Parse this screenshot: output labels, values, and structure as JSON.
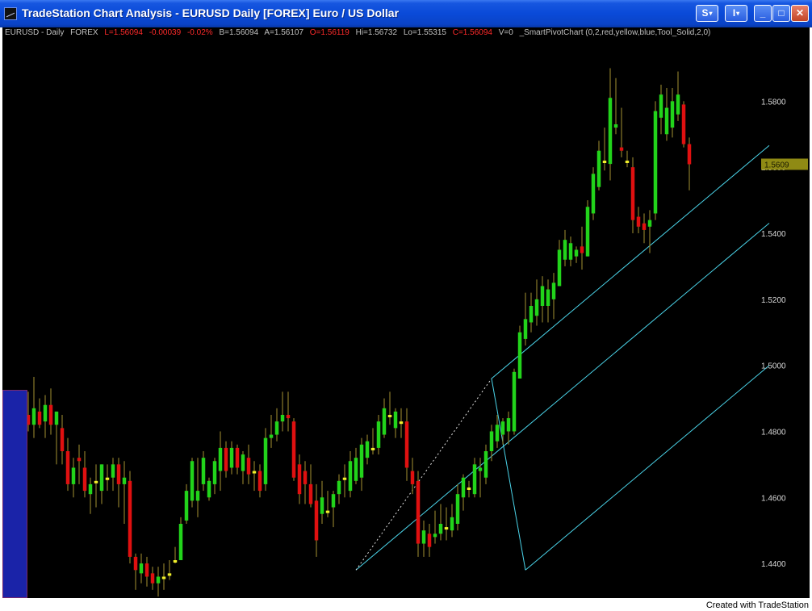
{
  "window": {
    "title": "TradeStation Chart Analysis - EURUSD  Daily  [FOREX] Euro / US Dollar",
    "buttons": {
      "s_label": "S",
      "i_label": "I",
      "caret": "▾",
      "minimize": "_",
      "maximize": "□",
      "close": "✕"
    }
  },
  "status": {
    "symbol": "EURUSD - Daily",
    "exchange": "FOREX",
    "last": "L=1.56094",
    "net_change": "-0.00039",
    "pct_change": "-0.02%",
    "bid": "B=1.56094",
    "ask": "A=1.56107",
    "open": "O=1.56119",
    "high": "Hi=1.56732",
    "low": "Lo=1.55315",
    "close": "C=1.56094",
    "volume": "V=0",
    "indicator": "_SmartPivotChart  (0,2,red,yellow,blue,Tool_Solid,2,0)"
  },
  "price_axis": {
    "labels": [
      "1.5800",
      "1.5600",
      "1.5400",
      "1.5200",
      "1.5000",
      "1.4800",
      "1.4600",
      "1.4400"
    ],
    "current_price_label": "1.5609"
  },
  "footer": {
    "watermark": "Created with TradeStation"
  },
  "chart_data": {
    "type": "candlestick",
    "symbol": "EURUSD",
    "interval": "Daily",
    "y_range": [
      1.43,
      1.595
    ],
    "y_ticks": [
      1.44,
      1.46,
      1.48,
      1.5,
      1.52,
      1.54,
      1.56,
      1.58
    ],
    "last_price": 1.5609,
    "colors": {
      "up": "#22d41b",
      "down": "#e01010",
      "doji": "#f0f02a",
      "wick": "#8a7a2a",
      "channel": "#4ad3e8",
      "pivot_line": "#e0e0e0",
      "background": "#000000",
      "last_price_tag": "#8f8a14"
    },
    "candles": [
      {
        "o": 1.464,
        "h": 1.4685,
        "l": 1.458,
        "c": 1.466
      },
      {
        "o": 1.466,
        "h": 1.469,
        "l": 1.462,
        "c": 1.463
      },
      {
        "o": 1.464,
        "h": 1.48,
        "l": 1.462,
        "c": 1.478
      },
      {
        "o": 1.477,
        "h": 1.49,
        "l": 1.474,
        "c": 1.487
      },
      {
        "o": 1.485,
        "h": 1.492,
        "l": 1.48,
        "c": 1.482
      },
      {
        "o": 1.482,
        "h": 1.4965,
        "l": 1.478,
        "c": 1.487
      },
      {
        "o": 1.486,
        "h": 1.49,
        "l": 1.481,
        "c": 1.482
      },
      {
        "o": 1.483,
        "h": 1.491,
        "l": 1.478,
        "c": 1.488
      },
      {
        "o": 1.488,
        "h": 1.493,
        "l": 1.479,
        "c": 1.482
      },
      {
        "o": 1.482,
        "h": 1.486,
        "l": 1.47,
        "c": 1.486
      },
      {
        "o": 1.481,
        "h": 1.485,
        "l": 1.47,
        "c": 1.474
      },
      {
        "o": 1.474,
        "h": 1.478,
        "l": 1.462,
        "c": 1.464
      },
      {
        "o": 1.464,
        "h": 1.472,
        "l": 1.46,
        "c": 1.469
      },
      {
        "o": 1.472,
        "h": 1.476,
        "l": 1.464,
        "c": 1.471
      },
      {
        "o": 1.469,
        "h": 1.474,
        "l": 1.46,
        "c": 1.462
      },
      {
        "o": 1.461,
        "h": 1.466,
        "l": 1.455,
        "c": 1.464
      },
      {
        "o": 1.465,
        "h": 1.47,
        "l": 1.457,
        "c": 1.465
      },
      {
        "o": 1.462,
        "h": 1.47,
        "l": 1.458,
        "c": 1.47
      },
      {
        "o": 1.466,
        "h": 1.47,
        "l": 1.462,
        "c": 1.466
      },
      {
        "o": 1.466,
        "h": 1.472,
        "l": 1.462,
        "c": 1.47
      },
      {
        "o": 1.47,
        "h": 1.472,
        "l": 1.457,
        "c": 1.464
      },
      {
        "o": 1.464,
        "h": 1.471,
        "l": 1.452,
        "c": 1.466
      },
      {
        "o": 1.465,
        "h": 1.468,
        "l": 1.44,
        "c": 1.442
      },
      {
        "o": 1.442,
        "h": 1.443,
        "l": 1.432,
        "c": 1.438
      },
      {
        "o": 1.437,
        "h": 1.443,
        "l": 1.434,
        "c": 1.44
      },
      {
        "o": 1.44,
        "h": 1.442,
        "l": 1.433,
        "c": 1.436
      },
      {
        "o": 1.437,
        "h": 1.439,
        "l": 1.432,
        "c": 1.434
      },
      {
        "o": 1.434,
        "h": 1.439,
        "l": 1.43,
        "c": 1.436
      },
      {
        "o": 1.436,
        "h": 1.44,
        "l": 1.432,
        "c": 1.436
      },
      {
        "o": 1.437,
        "h": 1.441,
        "l": 1.435,
        "c": 1.437
      },
      {
        "o": 1.441,
        "h": 1.445,
        "l": 1.44,
        "c": 1.441
      },
      {
        "o": 1.441,
        "h": 1.454,
        "l": 1.441,
        "c": 1.452
      },
      {
        "o": 1.453,
        "h": 1.464,
        "l": 1.452,
        "c": 1.462
      },
      {
        "o": 1.459,
        "h": 1.472,
        "l": 1.457,
        "c": 1.471
      },
      {
        "o": 1.459,
        "h": 1.472,
        "l": 1.454,
        "c": 1.462
      },
      {
        "o": 1.464,
        "h": 1.474,
        "l": 1.462,
        "c": 1.472
      },
      {
        "o": 1.46,
        "h": 1.466,
        "l": 1.459,
        "c": 1.465
      },
      {
        "o": 1.464,
        "h": 1.472,
        "l": 1.461,
        "c": 1.471
      },
      {
        "o": 1.468,
        "h": 1.48,
        "l": 1.462,
        "c": 1.475
      },
      {
        "o": 1.475,
        "h": 1.477,
        "l": 1.466,
        "c": 1.468
      },
      {
        "o": 1.469,
        "h": 1.477,
        "l": 1.467,
        "c": 1.475
      },
      {
        "o": 1.475,
        "h": 1.476,
        "l": 1.467,
        "c": 1.469
      },
      {
        "o": 1.468,
        "h": 1.474,
        "l": 1.464,
        "c": 1.473
      },
      {
        "o": 1.472,
        "h": 1.476,
        "l": 1.464,
        "c": 1.467
      },
      {
        "o": 1.468,
        "h": 1.471,
        "l": 1.462,
        "c": 1.468
      },
      {
        "o": 1.468,
        "h": 1.47,
        "l": 1.46,
        "c": 1.462
      },
      {
        "o": 1.464,
        "h": 1.481,
        "l": 1.462,
        "c": 1.478
      },
      {
        "o": 1.478,
        "h": 1.485,
        "l": 1.475,
        "c": 1.479
      },
      {
        "o": 1.479,
        "h": 1.487,
        "l": 1.477,
        "c": 1.483
      },
      {
        "o": 1.483,
        "h": 1.492,
        "l": 1.48,
        "c": 1.485
      },
      {
        "o": 1.485,
        "h": 1.492,
        "l": 1.48,
        "c": 1.484
      },
      {
        "o": 1.483,
        "h": 1.484,
        "l": 1.465,
        "c": 1.466
      },
      {
        "o": 1.47,
        "h": 1.473,
        "l": 1.458,
        "c": 1.461
      },
      {
        "o": 1.468,
        "h": 1.471,
        "l": 1.458,
        "c": 1.464
      },
      {
        "o": 1.464,
        "h": 1.47,
        "l": 1.457,
        "c": 1.458
      },
      {
        "o": 1.459,
        "h": 1.464,
        "l": 1.442,
        "c": 1.447
      },
      {
        "o": 1.455,
        "h": 1.465,
        "l": 1.452,
        "c": 1.46
      },
      {
        "o": 1.456,
        "h": 1.462,
        "l": 1.454,
        "c": 1.456
      },
      {
        "o": 1.457,
        "h": 1.462,
        "l": 1.451,
        "c": 1.461
      },
      {
        "o": 1.461,
        "h": 1.467,
        "l": 1.458,
        "c": 1.465
      },
      {
        "o": 1.466,
        "h": 1.47,
        "l": 1.46,
        "c": 1.466
      },
      {
        "o": 1.462,
        "h": 1.474,
        "l": 1.46,
        "c": 1.471
      },
      {
        "o": 1.465,
        "h": 1.475,
        "l": 1.464,
        "c": 1.472
      },
      {
        "o": 1.466,
        "h": 1.478,
        "l": 1.462,
        "c": 1.476
      },
      {
        "o": 1.472,
        "h": 1.479,
        "l": 1.47,
        "c": 1.477
      },
      {
        "o": 1.475,
        "h": 1.481,
        "l": 1.473,
        "c": 1.475
      },
      {
        "o": 1.475,
        "h": 1.485,
        "l": 1.473,
        "c": 1.483
      },
      {
        "o": 1.479,
        "h": 1.49,
        "l": 1.478,
        "c": 1.487
      },
      {
        "o": 1.485,
        "h": 1.492,
        "l": 1.482,
        "c": 1.485
      },
      {
        "o": 1.481,
        "h": 1.487,
        "l": 1.478,
        "c": 1.486
      },
      {
        "o": 1.483,
        "h": 1.487,
        "l": 1.478,
        "c": 1.483
      },
      {
        "o": 1.483,
        "h": 1.487,
        "l": 1.465,
        "c": 1.469
      },
      {
        "o": 1.468,
        "h": 1.472,
        "l": 1.461,
        "c": 1.464
      },
      {
        "o": 1.465,
        "h": 1.468,
        "l": 1.442,
        "c": 1.446
      },
      {
        "o": 1.446,
        "h": 1.453,
        "l": 1.442,
        "c": 1.45
      },
      {
        "o": 1.449,
        "h": 1.452,
        "l": 1.442,
        "c": 1.445
      },
      {
        "o": 1.448,
        "h": 1.456,
        "l": 1.446,
        "c": 1.449
      },
      {
        "o": 1.449,
        "h": 1.458,
        "l": 1.447,
        "c": 1.452
      },
      {
        "o": 1.451,
        "h": 1.457,
        "l": 1.447,
        "c": 1.451
      },
      {
        "o": 1.45,
        "h": 1.458,
        "l": 1.448,
        "c": 1.454
      },
      {
        "o": 1.452,
        "h": 1.464,
        "l": 1.45,
        "c": 1.461
      },
      {
        "o": 1.46,
        "h": 1.467,
        "l": 1.456,
        "c": 1.466
      },
      {
        "o": 1.463,
        "h": 1.465,
        "l": 1.46,
        "c": 1.463
      },
      {
        "o": 1.461,
        "h": 1.472,
        "l": 1.46,
        "c": 1.47
      },
      {
        "o": 1.468,
        "h": 1.472,
        "l": 1.46,
        "c": 1.469
      },
      {
        "o": 1.466,
        "h": 1.476,
        "l": 1.464,
        "c": 1.474
      },
      {
        "o": 1.474,
        "h": 1.482,
        "l": 1.471,
        "c": 1.48
      },
      {
        "o": 1.477,
        "h": 1.485,
        "l": 1.475,
        "c": 1.482
      },
      {
        "o": 1.479,
        "h": 1.484,
        "l": 1.476,
        "c": 1.483
      },
      {
        "o": 1.48,
        "h": 1.486,
        "l": 1.476,
        "c": 1.484
      },
      {
        "o": 1.48,
        "h": 1.499,
        "l": 1.479,
        "c": 1.498
      },
      {
        "o": 1.496,
        "h": 1.512,
        "l": 1.496,
        "c": 1.51
      },
      {
        "o": 1.508,
        "h": 1.522,
        "l": 1.506,
        "c": 1.514
      },
      {
        "o": 1.513,
        "h": 1.522,
        "l": 1.51,
        "c": 1.518
      },
      {
        "o": 1.515,
        "h": 1.526,
        "l": 1.512,
        "c": 1.52
      },
      {
        "o": 1.518,
        "h": 1.527,
        "l": 1.513,
        "c": 1.524
      },
      {
        "o": 1.518,
        "h": 1.526,
        "l": 1.513,
        "c": 1.523
      },
      {
        "o": 1.52,
        "h": 1.528,
        "l": 1.514,
        "c": 1.525
      },
      {
        "o": 1.524,
        "h": 1.538,
        "l": 1.524,
        "c": 1.535
      },
      {
        "o": 1.532,
        "h": 1.541,
        "l": 1.53,
        "c": 1.538
      },
      {
        "o": 1.532,
        "h": 1.539,
        "l": 1.53,
        "c": 1.537
      },
      {
        "o": 1.533,
        "h": 1.536,
        "l": 1.531,
        "c": 1.535
      },
      {
        "o": 1.536,
        "h": 1.542,
        "l": 1.529,
        "c": 1.534
      },
      {
        "o": 1.533,
        "h": 1.55,
        "l": 1.533,
        "c": 1.548
      },
      {
        "o": 1.546,
        "h": 1.56,
        "l": 1.544,
        "c": 1.558
      },
      {
        "o": 1.554,
        "h": 1.568,
        "l": 1.553,
        "c": 1.565
      },
      {
        "o": 1.562,
        "h": 1.572,
        "l": 1.559,
        "c": 1.562
      },
      {
        "o": 1.561,
        "h": 1.59,
        "l": 1.556,
        "c": 1.581
      },
      {
        "o": 1.572,
        "h": 1.587,
        "l": 1.57,
        "c": 1.573
      },
      {
        "o": 1.566,
        "h": 1.578,
        "l": 1.563,
        "c": 1.565
      },
      {
        "o": 1.562,
        "h": 1.565,
        "l": 1.56,
        "c": 1.562
      },
      {
        "o": 1.56,
        "h": 1.563,
        "l": 1.54,
        "c": 1.544
      },
      {
        "o": 1.545,
        "h": 1.548,
        "l": 1.54,
        "c": 1.542
      },
      {
        "o": 1.543,
        "h": 1.546,
        "l": 1.537,
        "c": 1.541
      },
      {
        "o": 1.542,
        "h": 1.547,
        "l": 1.534,
        "c": 1.544
      },
      {
        "o": 1.546,
        "h": 1.58,
        "l": 1.544,
        "c": 1.577
      },
      {
        "o": 1.575,
        "h": 1.585,
        "l": 1.57,
        "c": 1.582
      },
      {
        "o": 1.57,
        "h": 1.584,
        "l": 1.568,
        "c": 1.578
      },
      {
        "o": 1.572,
        "h": 1.584,
        "l": 1.569,
        "c": 1.58
      },
      {
        "o": 1.576,
        "h": 1.589,
        "l": 1.574,
        "c": 1.582
      },
      {
        "o": 1.579,
        "h": 1.58,
        "l": 1.566,
        "c": 1.567
      },
      {
        "o": 1.567,
        "h": 1.569,
        "l": 1.553,
        "c": 1.5609
      }
    ],
    "pivot_zigzag": [
      {
        "bar": 62,
        "price": 1.438
      },
      {
        "bar": 86,
        "price": 1.496
      },
      {
        "bar": 92,
        "price": 1.438
      },
      {
        "bar": 168,
        "price": 1.59
      }
    ],
    "channel": {
      "anchor_low": {
        "bar": 62,
        "price": 1.438
      },
      "anchor_high": {
        "bar": 86,
        "price": 1.496
      },
      "slope_bar_to": 92,
      "slope_price_to": 1.438
    }
  }
}
